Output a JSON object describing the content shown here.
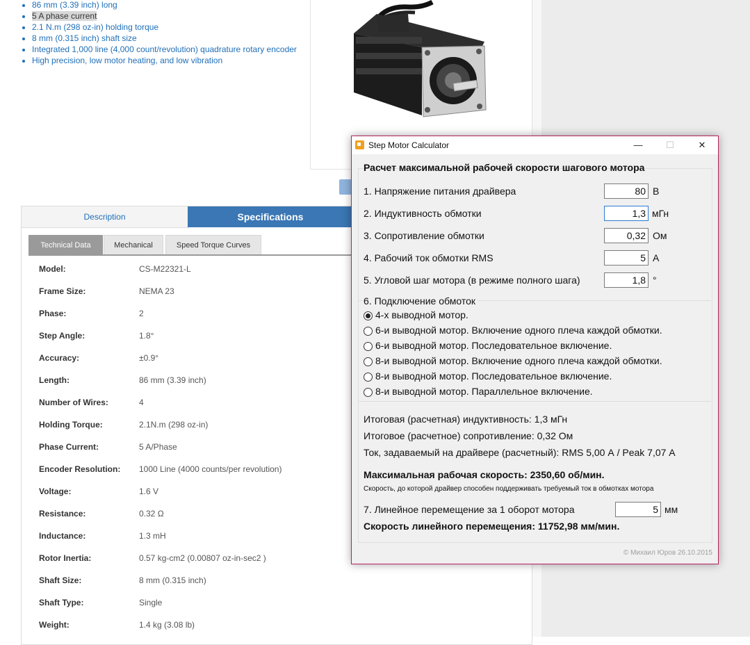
{
  "features": [
    "86 mm (3.39 inch) long",
    "5 A phase current",
    "2.1 N.m (298 oz-in) holding torque",
    "8 mm (0.315 inch) shaft size",
    "Integrated 1,000 line (4,000 count/revolution) quadrature rotary encoder",
    "High precision, low motor heating, and low vibration"
  ],
  "tabs": {
    "description": "Description",
    "specifications": "Specifications"
  },
  "subtabs": [
    "Technical Data",
    "Mechanical",
    "Speed Torque Curves"
  ],
  "specs": [
    {
      "k": "Model:",
      "v": "CS-M22321-L"
    },
    {
      "k": "Frame Size:",
      "v": "NEMA 23"
    },
    {
      "k": "Phase:",
      "v": "2"
    },
    {
      "k": "Step Angle:",
      "v": "1.8°"
    },
    {
      "k": "Accuracy:",
      "v": "±0.9°"
    },
    {
      "k": "Length:",
      "v": "86 mm (3.39 inch)"
    },
    {
      "k": "Number of Wires:",
      "v": "4"
    },
    {
      "k": "Holding Torque:",
      "v": "2.1N.m (298 oz-in)"
    },
    {
      "k": "Phase Current:",
      "v": "5 A/Phase"
    },
    {
      "k": "Encoder Resolution:",
      "v": "1000 Line (4000 counts/per revolution)"
    },
    {
      "k": "Voltage:",
      "v": "1.6 V"
    },
    {
      "k": "Resistance:",
      "v": "0.32 Ω"
    },
    {
      "k": "Inductance:",
      "v": "1.3 mH"
    },
    {
      "k": "Rotor Inertia:",
      "v": "0.57 kg-cm2 (0.00807 oz-in-sec2 )"
    },
    {
      "k": "Shaft Size:",
      "v": "8 mm (0.315 inch)"
    },
    {
      "k": "Shaft Type:",
      "v": "Single"
    },
    {
      "k": "Weight:",
      "v": "1.4 kg (3.08 lb)"
    }
  ],
  "dialog": {
    "title": "Step Motor Calculator",
    "heading": "Расчет максимальной  рабочей скорости шагового мотора",
    "fields": [
      {
        "label": "1. Напряжение питания драйвера",
        "value": "80",
        "unit": "В"
      },
      {
        "label": "2. Индуктивность обмотки",
        "value": "1,3",
        "unit": "мГн"
      },
      {
        "label": "3. Сопротивление обмотки",
        "value": "0,32",
        "unit": "Ом"
      },
      {
        "label": "4. Рабочий ток обмотки RMS",
        "value": "5",
        "unit": "А"
      },
      {
        "label": "5. Угловой шаг мотора (в режиме полного шага)",
        "value": "1,8",
        "unit": "°"
      }
    ],
    "connection_label": "6. Подключение обмоток",
    "connection_options": [
      "4-х выводной мотор.",
      "6-и выводной мотор. Включение одного плеча каждой обмотки.",
      "6-и выводной мотор. Последовательное включение.",
      "8-и выводной мотор. Включение одного плеча каждой обмотки.",
      "8-и выводной мотор. Последовательное включение.",
      "8-и выводной мотор. Параллельное включение."
    ],
    "selected_option": 0,
    "result_inductance": "Итоговая (расчетная) индуктивность: 1,3 мГн",
    "result_resistance": "Итоговое (расчетное) сопротивление: 0,32 Ом",
    "result_current": "Ток, задаваемый на драйвере (расчетный): RMS 5,00 А / Peak 7,07 А",
    "max_speed": "Максимальная рабочая скорость: 2350,60 об/мин.",
    "max_speed_note": "Скорость, до которой драйвер способен поддерживать требуемый ток в обмотках мотора",
    "linear": {
      "label": "7. Линейное перемещение за 1 оборот мотора",
      "value": "5",
      "unit": "мм"
    },
    "linear_speed": "Скорость линейного перемещения: 11752,98 мм/мин.",
    "copyright": "© Михаил Юров 26.10.2015"
  }
}
